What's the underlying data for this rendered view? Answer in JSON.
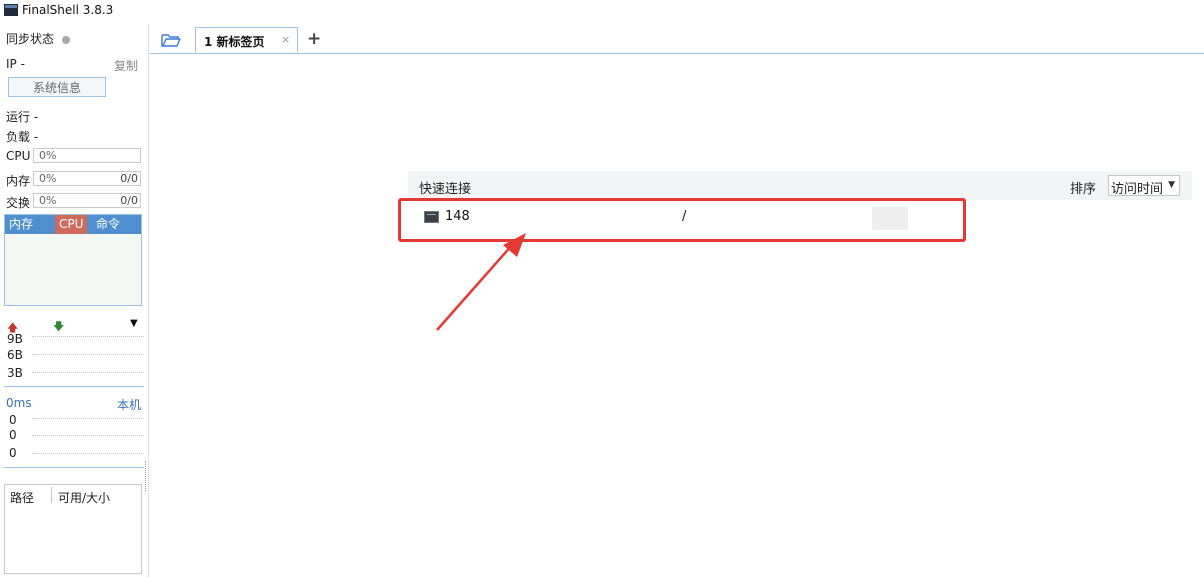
{
  "window": {
    "title": "FinalShell 3.8.3"
  },
  "sidebar": {
    "sync_label": "同步状态",
    "ip_label": "IP",
    "ip_value": "-",
    "copy_label": "复制",
    "sysinfo_button": "系统信息",
    "uptime_label": "运行",
    "uptime_value": "-",
    "load_label": "负载",
    "load_value": "-",
    "cpu": {
      "label": "CPU",
      "percent": "0%"
    },
    "memory": {
      "label": "内存",
      "percent": "0%",
      "ratio": "0/0"
    },
    "swap": {
      "label": "交换",
      "percent": "0%",
      "ratio": "0/0"
    },
    "process_tabs": [
      "内存",
      "CPU",
      "命令"
    ],
    "net": {
      "values": [
        "9B",
        "6B",
        "3B"
      ]
    },
    "ping": {
      "label": "0ms",
      "target": "本机",
      "values": [
        "0",
        "0",
        "0"
      ]
    },
    "disk": {
      "col_path": "路径",
      "col_size": "可用/大小"
    }
  },
  "tabs": [
    {
      "label": "1 新标签页",
      "active": true
    }
  ],
  "tab_add": "+",
  "tab_close": "×",
  "quick_connect": {
    "title": "快速连接",
    "sort_label": "排序",
    "sort_value": "访问时间",
    "rows": [
      {
        "name": "148",
        "path": "/"
      }
    ]
  },
  "colors": {
    "accent_blue": "#4f8fd0",
    "cpu_tab_red": "#d06a5c",
    "highlight_red": "#e53935"
  }
}
